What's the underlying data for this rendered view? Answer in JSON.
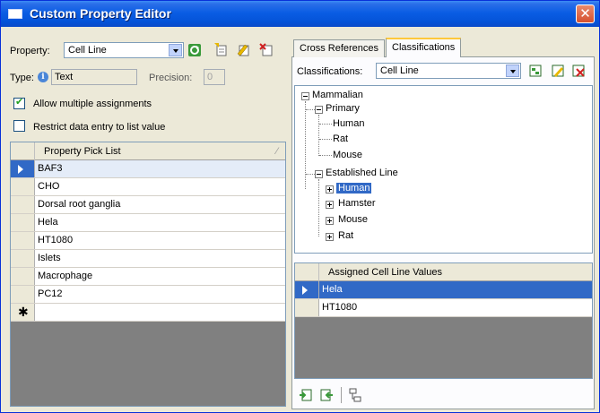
{
  "window": {
    "title": "Custom Property Editor",
    "close_glyph": "✕"
  },
  "left": {
    "property_label": "Property:",
    "property_value": "Cell Line",
    "type_label": "Type:",
    "type_value": "Text",
    "precision_label": "Precision:",
    "precision_value": "0",
    "allow_multiple_label": "Allow multiple assignments",
    "allow_multiple_checked": true,
    "restrict_label": "Restrict data entry to list value",
    "restrict_checked": false,
    "pick_list": {
      "header": "Property Pick List",
      "rows": [
        "BAF3",
        "CHO",
        "Dorsal root ganglia",
        "Hela",
        "HT1080",
        "Islets",
        "Macrophage",
        "PC12"
      ],
      "new_row_glyph": "✱"
    }
  },
  "right": {
    "tabs": [
      {
        "label": "Cross References",
        "active": false
      },
      {
        "label": "Classifications",
        "active": true
      }
    ],
    "classifications_label": "Classifications:",
    "classifications_value": "Cell Line",
    "tree": {
      "root": "Mammalian",
      "primary": "Primary",
      "primary_children": [
        "Human",
        "Rat",
        "Mouse"
      ],
      "established": "Established Line",
      "established_children": [
        "Human",
        "Hamster",
        "Mouse",
        "Rat"
      ]
    },
    "assigned": {
      "header": "Assigned Cell Line Values",
      "rows": [
        "Hela",
        "HT1080"
      ]
    }
  },
  "colors": {
    "titlebar": "#0453d8",
    "selection": "#3169c6",
    "chrome": "#ece9d8"
  }
}
